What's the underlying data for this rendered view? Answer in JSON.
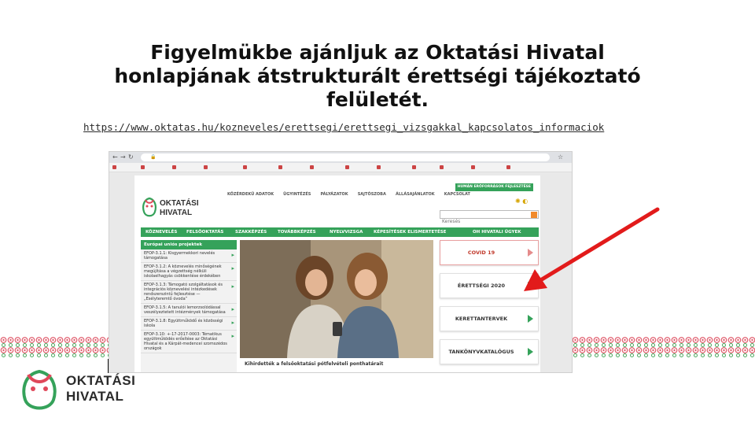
{
  "slide": {
    "title_line1": "Figyelmükbe ajánljuk az Oktatási Hivatal",
    "title_line2": "honlapjának átstrukturált érettségi tájékoztató",
    "title_line3": "felületét.",
    "link": "https://www.oktatas.hu/kozneveles/erettsegi/erettsegi_vizsgakkal_kapcsolatos_informaciok",
    "logo_line1": "OKTATÁSI",
    "logo_line2": "HIVATAL"
  },
  "site": {
    "logo_line1": "OKTATÁSI",
    "logo_line2": "HIVATAL",
    "top_nav": [
      "KÖZÉRDEKŰ ADATOK",
      "ÜGYINTÉZÉS",
      "PÁLYÁZATOK",
      "SAJTÓSZOBA",
      "ÁLLÁSAJÁNLATOK",
      "KAPCSOLAT"
    ],
    "top_nav_pill": "HUMÁN ERŐFORRÁSOK FEJLESZTÉSE",
    "search_placeholder": "Keresés",
    "main_menu": [
      "KÖZNEVELÉS",
      "FELSŐOKTATÁS",
      "SZAKKÉPZÉS",
      "TOVÁBBKÉPZÉS",
      "NYELVVIZSGA",
      "KÉPESÍTÉSEK ELISMERTETÉSE",
      "OH HIVATALI ÜGYEK"
    ],
    "sidebar_head": "Európai uniós projektek",
    "sidebar_items": [
      "EFOP-3.1.1: Kisgyermekkori nevelés támogatása",
      "EFOP-3.1.2: A köznevelés minőségének megújítása a végzettség nélküli iskolaelhagyás csökkentése érdekében",
      "EFOP-3.1.3: Támogató szolgáltatások és integrációs köznevelési intézkedések rendszerszintű fejlesztése — „Esélyteremtő óvoda”",
      "EFOP-3.1.5: A tanulói lemorzsolódással veszélyeztetett intézmények támogatása",
      "EFOP-3.1.8: Együttműködő és közösségi iskola",
      "EFOP-3.10: +-17-2017-0003: Tématikus együttműködés erősítése az Oktatási Hivatal és a Kárpát-medencei szomszédos országok"
    ],
    "hero_caption": "Kihirdették a felsőoktatási pótfelvételi ponthatárait",
    "right_boxes": [
      "COVID 19",
      "ÉRETTSÉGI 2020",
      "KERETTANTERVEK",
      "TANKÖNYVKATALÓGUS"
    ]
  },
  "colors": {
    "brand_green": "#35a25a",
    "arrow_red": "#e21b1b"
  }
}
